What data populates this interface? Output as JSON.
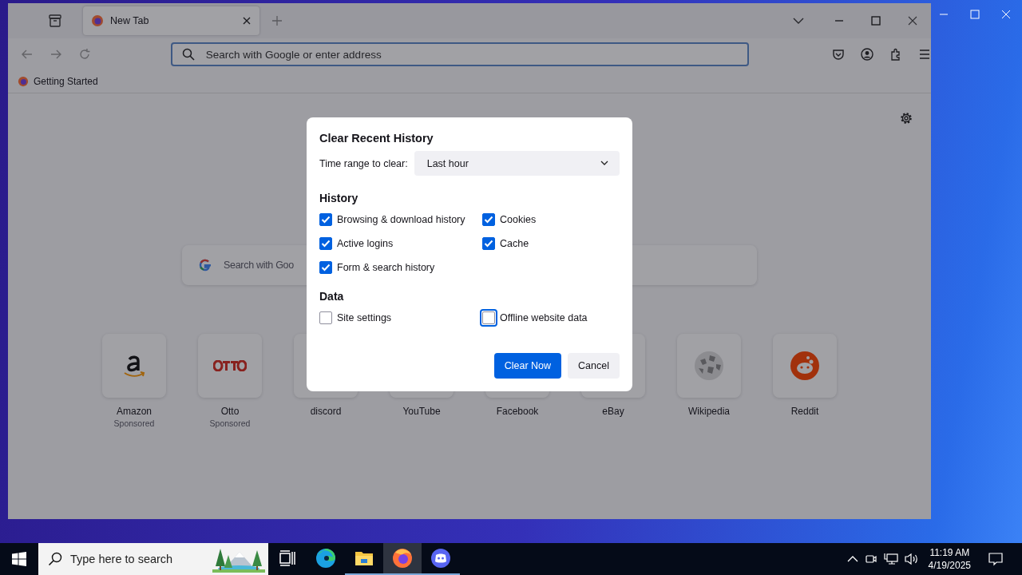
{
  "browser": {
    "tabs": [
      {
        "title": "New Tab",
        "selected": true
      }
    ],
    "address_bar": {
      "placeholder": "Search with Google or enter address"
    },
    "bookmarks": [
      {
        "label": "Getting Started"
      }
    ]
  },
  "new_tab": {
    "search": {
      "placeholder": "Search with Goo"
    },
    "shortcuts": [
      {
        "title": "Amazon",
        "subtitle": "Sponsored"
      },
      {
        "title": "Otto",
        "subtitle": "Sponsored"
      },
      {
        "title": "discord"
      },
      {
        "title": "YouTube"
      },
      {
        "title": "Facebook"
      },
      {
        "title": "eBay"
      },
      {
        "title": "Wikipedia"
      },
      {
        "title": "Reddit"
      }
    ]
  },
  "dialog": {
    "title": "Clear Recent History",
    "time_range": {
      "label": "Time range to clear:",
      "value": "Last hour"
    },
    "sections": [
      {
        "heading": "History",
        "options": [
          {
            "label": "Browsing & download history",
            "checked": true,
            "focused": false
          },
          {
            "label": "Cookies",
            "checked": true,
            "focused": false
          },
          {
            "label": "Active logins",
            "checked": true,
            "focused": false
          },
          {
            "label": "Cache",
            "checked": true,
            "focused": false
          },
          {
            "label": "Form & search history",
            "checked": true,
            "focused": false
          }
        ]
      },
      {
        "heading": "Data",
        "options": [
          {
            "label": "Site settings",
            "checked": false,
            "focused": false
          },
          {
            "label": "Offline website data",
            "checked": false,
            "focused": true
          }
        ]
      }
    ],
    "buttons": [
      {
        "label": "Clear Now",
        "kind": "primary"
      },
      {
        "label": "Cancel",
        "kind": "secondary"
      }
    ]
  },
  "taskbar": {
    "search": {
      "placeholder": "Type here to search"
    },
    "apps": [
      {
        "selected": false,
        "running": false
      },
      {
        "selected": false,
        "running": false
      },
      {
        "selected": false,
        "running": true
      },
      {
        "selected": true,
        "running": true
      },
      {
        "selected": false,
        "running": true
      }
    ],
    "clock": {
      "time": "11:19 AM",
      "date": "4/19/2025"
    }
  }
}
